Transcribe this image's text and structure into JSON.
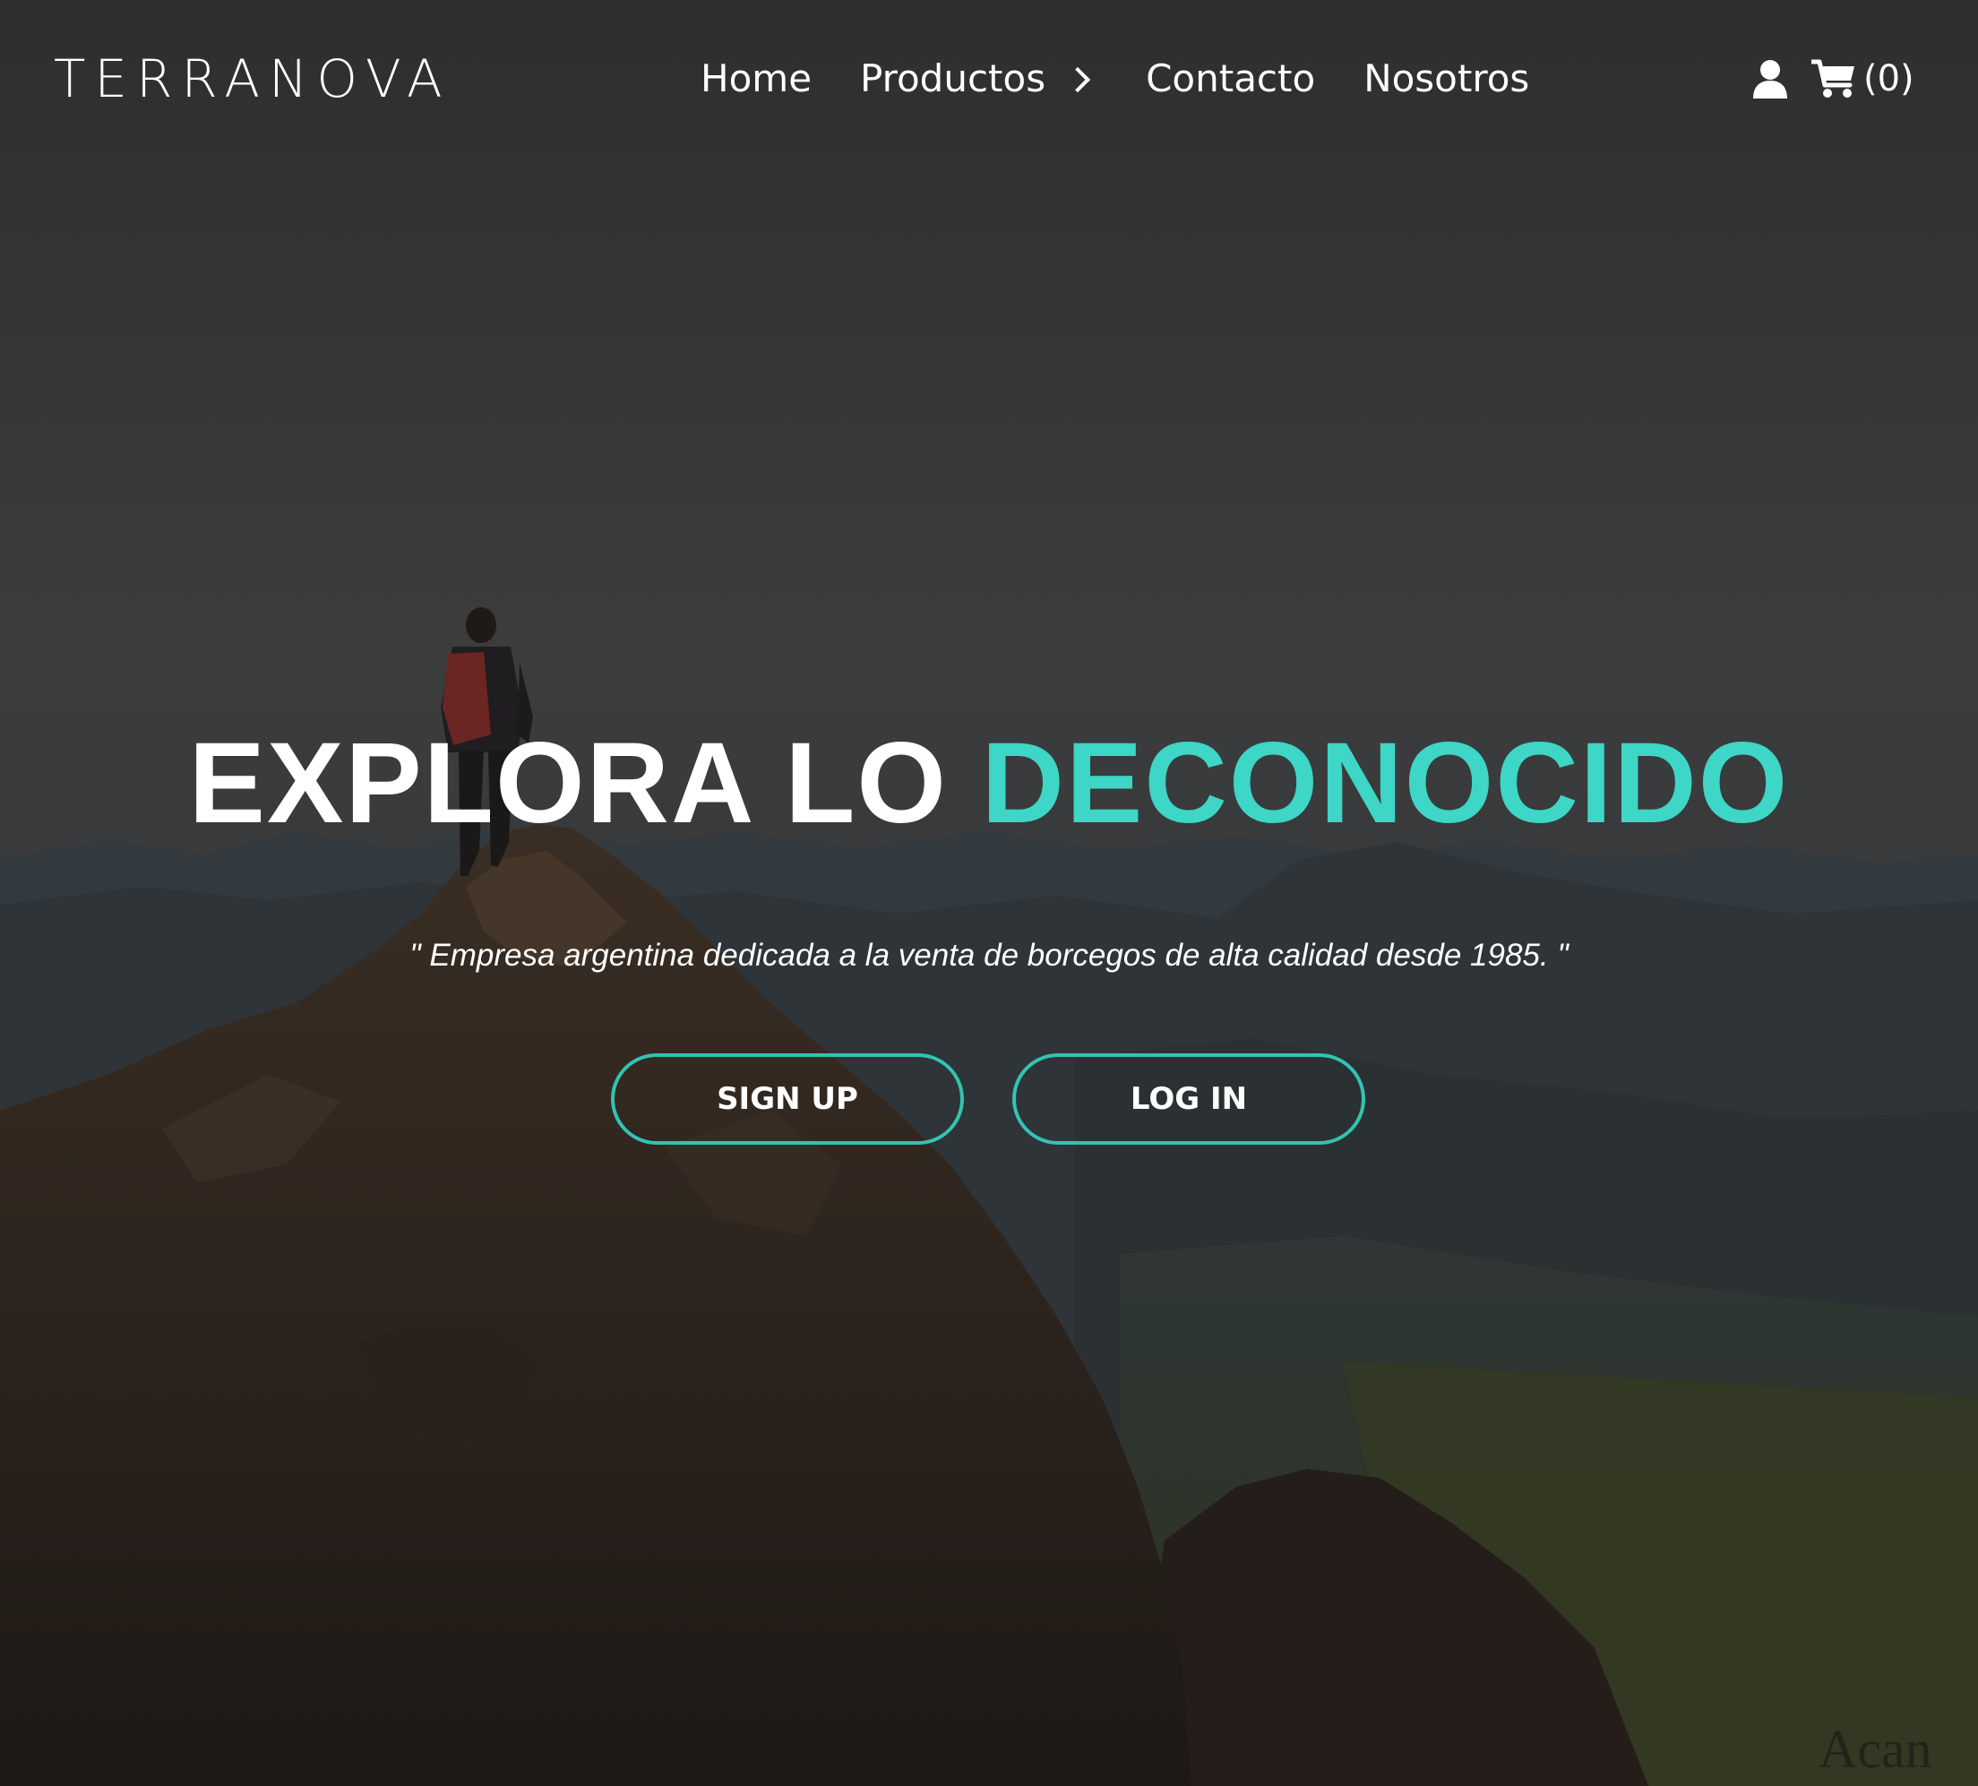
{
  "nav": {
    "brand": "TERRANOVA",
    "links": [
      {
        "label": "Home"
      },
      {
        "label": "Productos"
      },
      {
        "label": "Contacto"
      },
      {
        "label": "Nosotros"
      }
    ],
    "user_icon": "user-icon",
    "cart_icon": "cart-icon",
    "cart_count": "(0)"
  },
  "hero": {
    "title_part1": "EXPLORA LO ",
    "title_part2": "DECONOCIDO",
    "subtitle": "\" Empresa argentina dedicada a la venta de borcegos de alta calidad desde 1985. \"",
    "signup_label": "SIGN UP",
    "login_label": "LOG IN"
  },
  "watermark": "Acan",
  "colors": {
    "accent": "#3ed6c6",
    "button_border": "#33c3b3",
    "text": "#ffffff",
    "overlay": "#2e2f30"
  }
}
